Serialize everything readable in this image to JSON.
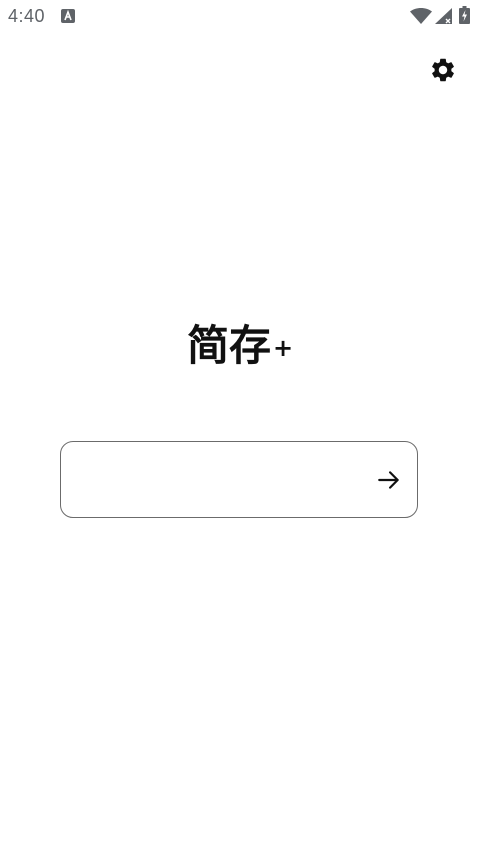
{
  "status_bar": {
    "time": "4:40",
    "notification_icon": "a-letter-icon",
    "wifi_icon": "wifi-icon",
    "signal_icon": "cell-signal-icon",
    "battery_icon": "battery-charging-icon"
  },
  "header": {
    "settings_icon": "gear-icon"
  },
  "main": {
    "title": "简存",
    "title_superscript": "+",
    "input": {
      "value": "",
      "placeholder": ""
    },
    "submit_icon": "arrow-right-icon"
  },
  "colors": {
    "background": "#ffffff",
    "text": "#111111",
    "status_icons": "#5f6368",
    "input_border": "#6b6b6b"
  }
}
